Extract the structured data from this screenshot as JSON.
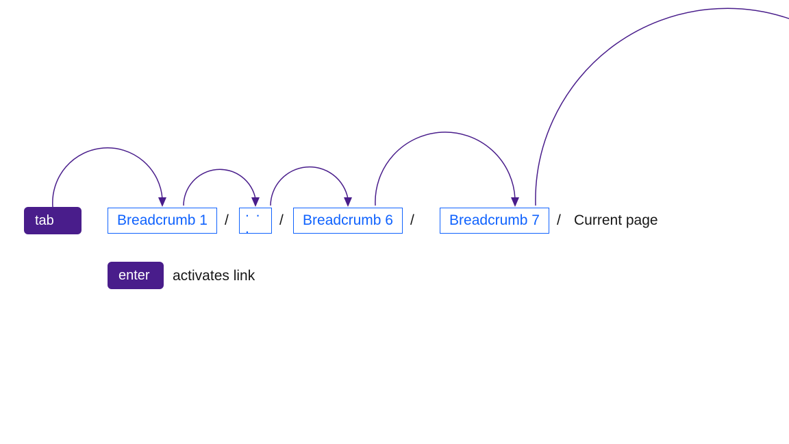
{
  "colors": {
    "key_bg": "#491d8b",
    "link": "#0f62fe",
    "text": "#161616"
  },
  "keys": {
    "tab": "tab",
    "enter": "enter"
  },
  "breadcrumbs": {
    "first": "Breadcrumb 1",
    "overflow": ". . .",
    "sixth": "Breadcrumb 6",
    "seventh": "Breadcrumb 7",
    "current": "Current page"
  },
  "separator": "/",
  "enter_description": "activates link"
}
